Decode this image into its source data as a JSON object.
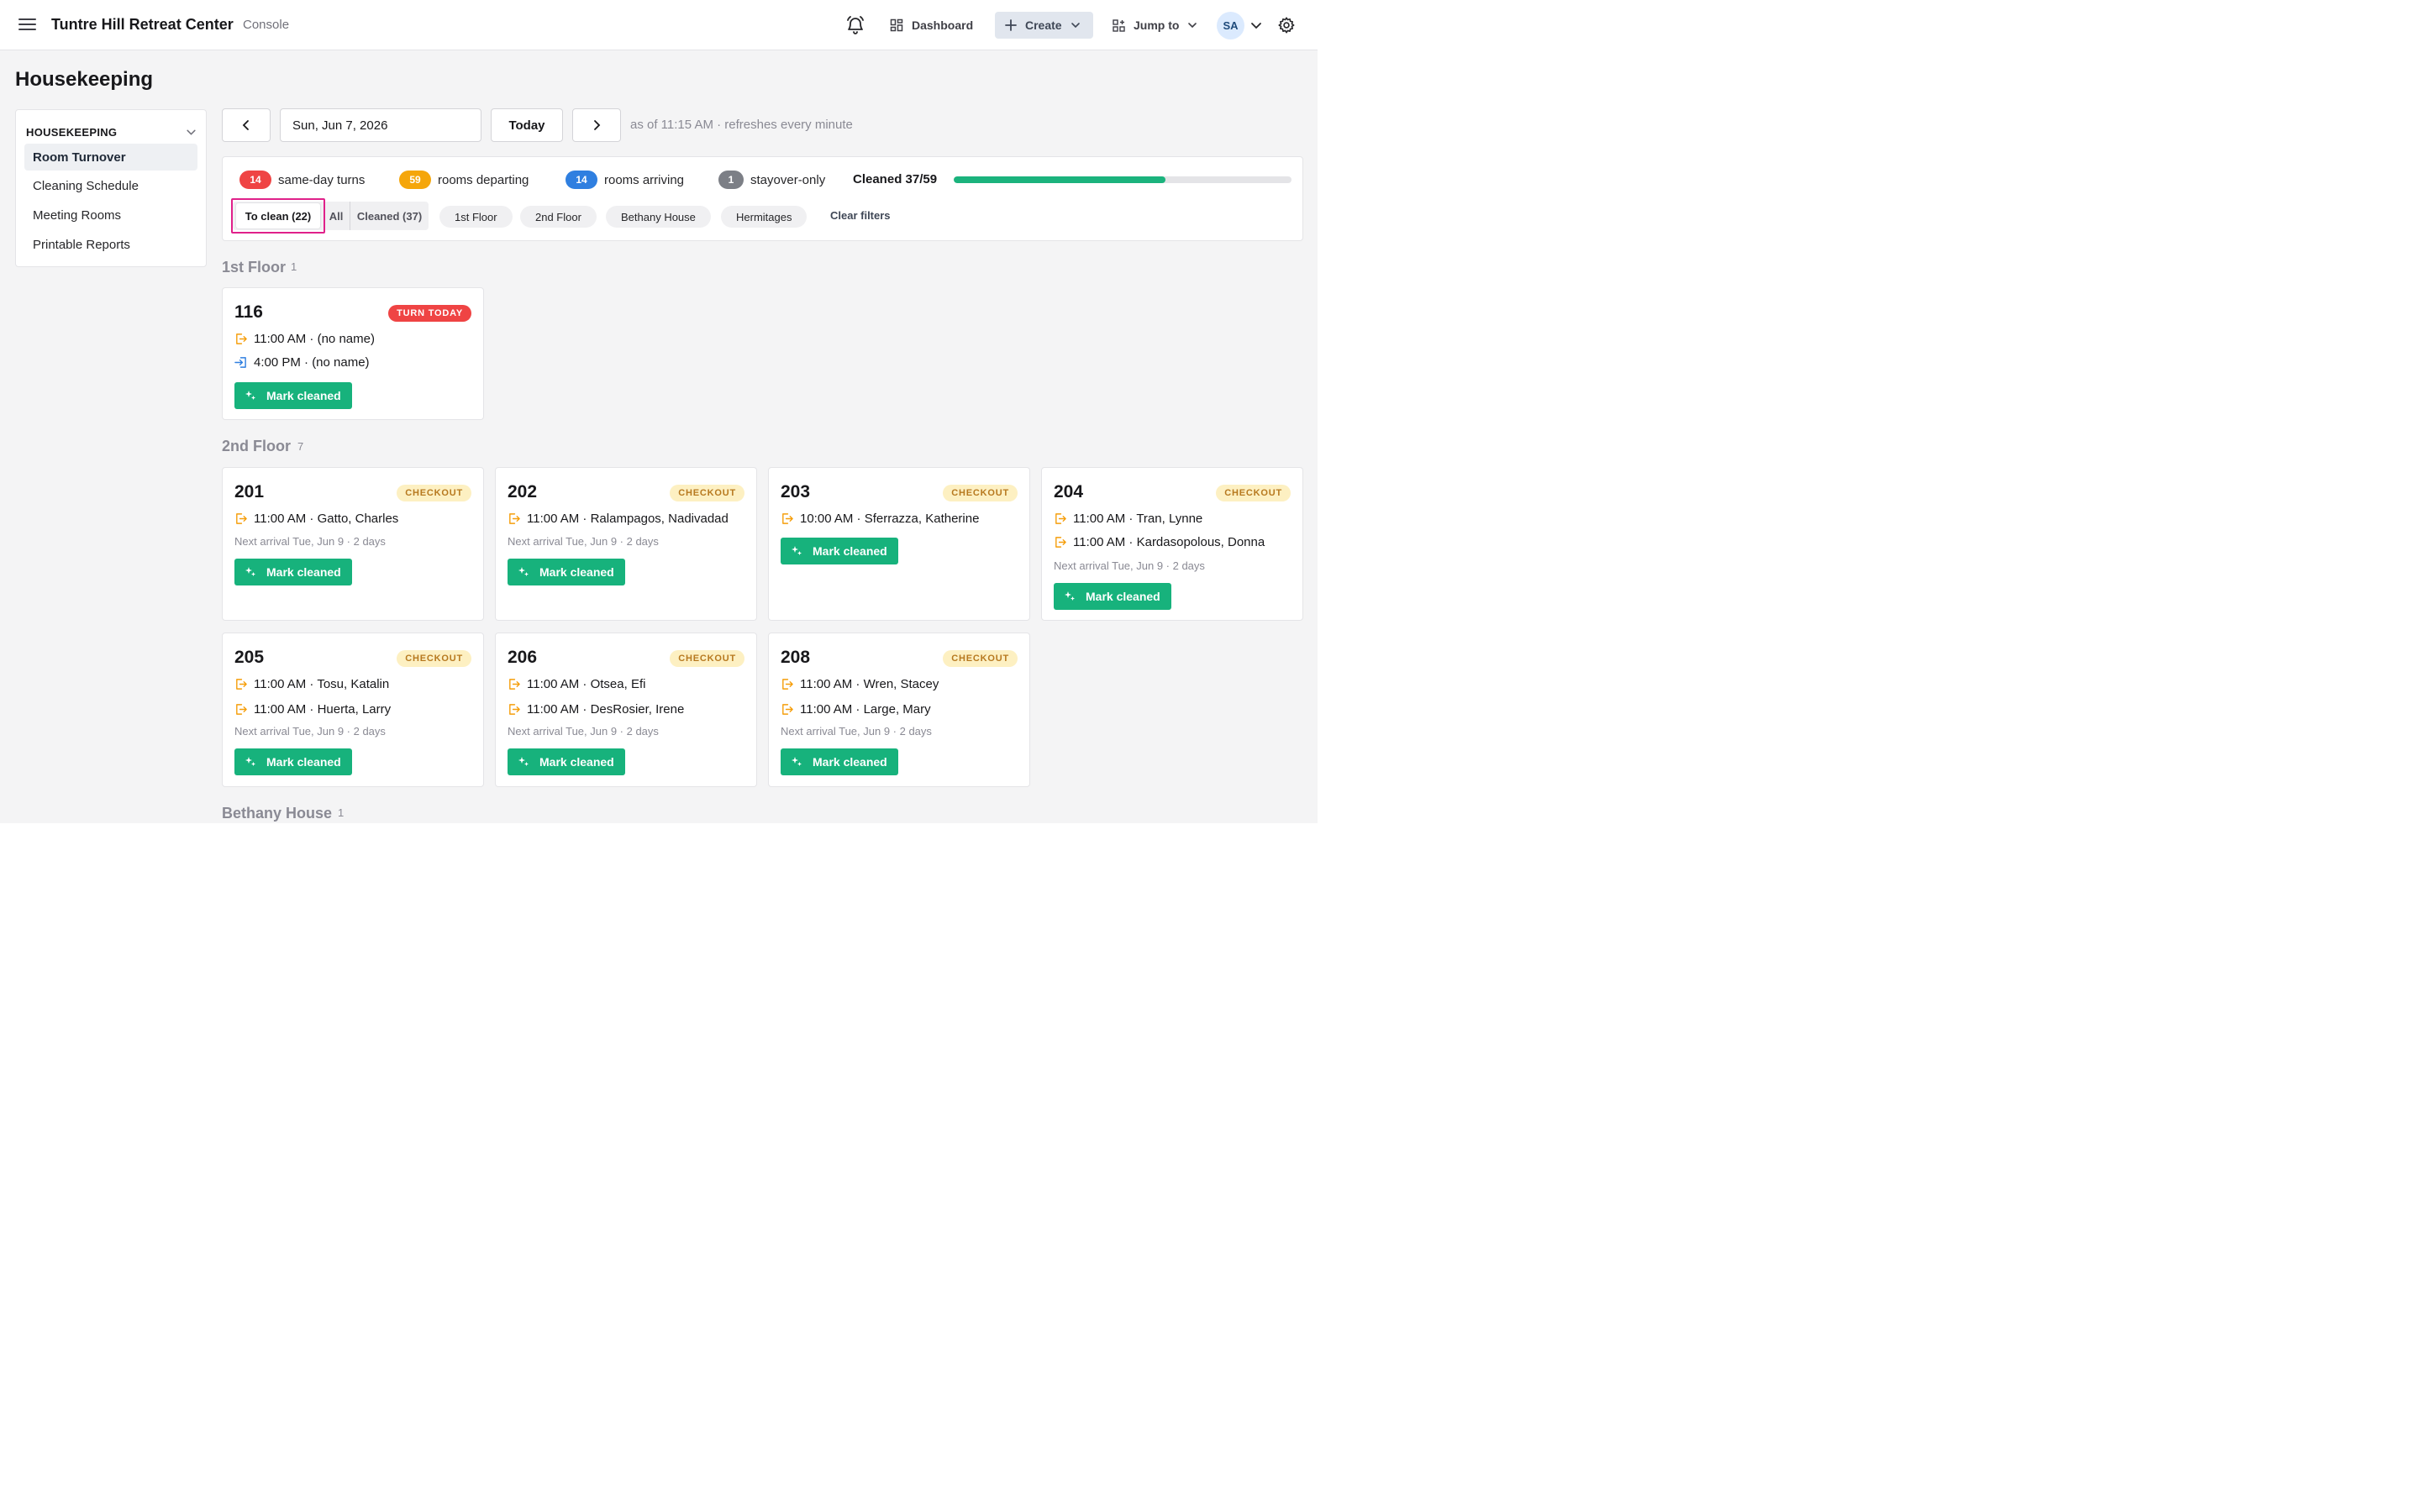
{
  "header": {
    "brand": "Tuntre Hill Retreat Center",
    "subtitle": "Console",
    "dashboard_label": "Dashboard",
    "create_label": "Create",
    "jump_label": "Jump to",
    "avatar_initials": "SA"
  },
  "page_title": "Housekeeping",
  "sidebar": {
    "heading": "HOUSEKEEPING",
    "items": [
      {
        "label": "Room Turnover",
        "active": true
      },
      {
        "label": "Cleaning Schedule",
        "active": false
      },
      {
        "label": "Meeting Rooms",
        "active": false
      },
      {
        "label": "Printable Reports",
        "active": false
      }
    ]
  },
  "date_nav": {
    "date_value": "Sun, Jun 7, 2026",
    "today_label": "Today",
    "refresh_note": "as of 11:15 AM · refreshes every minute"
  },
  "summary": {
    "stats": [
      {
        "count": "14",
        "label": "same-day turns",
        "color": "#ef4444"
      },
      {
        "count": "59",
        "label": "rooms departing",
        "color": "#f5a60b"
      },
      {
        "count": "14",
        "label": "rooms arriving",
        "color": "#2f7fe0"
      },
      {
        "count": "1",
        "label": "stayover-only",
        "color": "#7c7f86"
      }
    ],
    "cleaned_label": "Cleaned 37/59",
    "cleaned_fraction": 0.627,
    "progress_color": "#1bb37d"
  },
  "filters": {
    "tabs": {
      "to_clean": "To clean (22)",
      "all": "All",
      "cleaned": "Cleaned (37)"
    },
    "chips": [
      "1st Floor",
      "2nd Floor",
      "Bethany House",
      "Hermitages"
    ],
    "clear_label": "Clear filters"
  },
  "groups": {
    "floor1": {
      "title": "1st Floor",
      "count": "1"
    },
    "floor2": {
      "title": "2nd Floor",
      "count": "7"
    },
    "bethany": {
      "title": "Bethany House",
      "count": "1"
    }
  },
  "mark_cleaned_label": "Mark cleaned",
  "rooms": {
    "r116": {
      "room": "116",
      "tag": "TURN TODAY",
      "lines": [
        "11:00 AM · (no name)",
        "4:00 PM · (no name)"
      ]
    },
    "r201": {
      "room": "201",
      "tag": "CHECKOUT",
      "lines": [
        "11:00 AM · Gatto, Charles"
      ],
      "note": "Next arrival Tue, Jun 9 · 2 days"
    },
    "r202": {
      "room": "202",
      "tag": "CHECKOUT",
      "lines": [
        "11:00 AM · Ralampagos, Nadivadad"
      ],
      "note": "Next arrival Tue, Jun 9 · 2 days"
    },
    "r203": {
      "room": "203",
      "tag": "CHECKOUT",
      "lines": [
        "10:00 AM · Sferrazza, Katherine"
      ]
    },
    "r204": {
      "room": "204",
      "tag": "CHECKOUT",
      "lines": [
        "11:00 AM · Tran, Lynne",
        "11:00 AM · Kardasopolous, Donna"
      ],
      "note": "Next arrival Tue, Jun 9 · 2 days"
    },
    "r205": {
      "room": "205",
      "tag": "CHECKOUT",
      "lines": [
        "11:00 AM · Tosu, Katalin",
        "11:00 AM · Huerta, Larry"
      ],
      "note": "Next arrival Tue, Jun 9 · 2 days"
    },
    "r206": {
      "room": "206",
      "tag": "CHECKOUT",
      "lines": [
        "11:00 AM · Otsea, Efi",
        "11:00 AM · DesRosier, Irene"
      ],
      "note": "Next arrival Tue, Jun 9 · 2 days"
    },
    "r208": {
      "room": "208",
      "tag": "CHECKOUT",
      "lines": [
        "11:00 AM · Wren, Stacey",
        "11:00 AM · Large, Mary"
      ],
      "note": "Next arrival Tue, Jun 9 · 2 days"
    }
  },
  "icons": {
    "checkout_color": "#f59e0b",
    "checkin_color": "#2f7fe0"
  }
}
